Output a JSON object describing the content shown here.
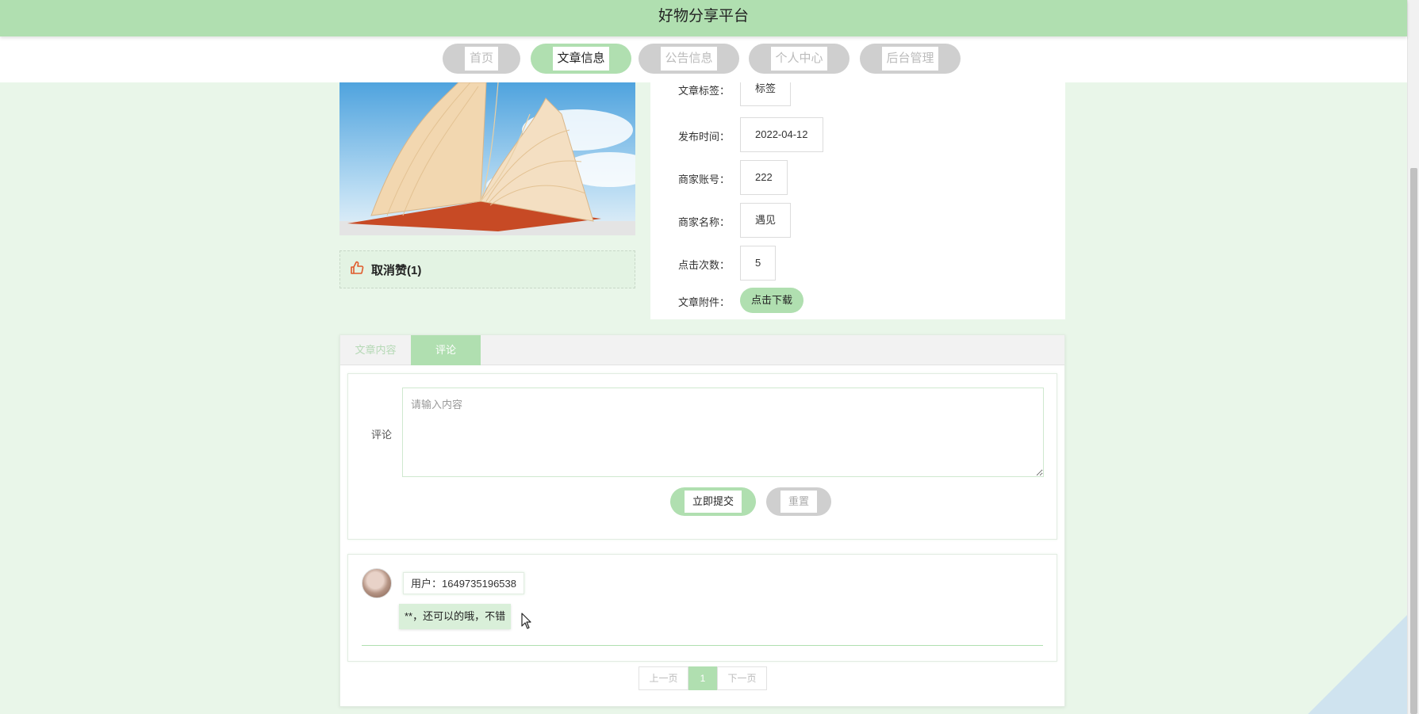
{
  "header": {
    "title": "好物分享平台"
  },
  "nav": {
    "items": [
      {
        "label": "首页"
      },
      {
        "label": "文章信息"
      },
      {
        "label": "公告信息"
      },
      {
        "label": "个人中心"
      },
      {
        "label": "后台管理"
      }
    ],
    "active_index": 1
  },
  "article": {
    "like_label": "取消赞(1)",
    "fields": [
      {
        "label": "文章标签：",
        "value": "标签"
      },
      {
        "label": "发布时间：",
        "value": "2022-04-12"
      },
      {
        "label": "商家账号：",
        "value": "222"
      },
      {
        "label": "商家名称：",
        "value": "遇见"
      },
      {
        "label": "点击次数：",
        "value": "5"
      }
    ],
    "attachment_label": "文章附件：",
    "download_label": "点击下载"
  },
  "tabs": [
    {
      "label": "文章内容"
    },
    {
      "label": "评论"
    }
  ],
  "comment_form": {
    "label": "评论",
    "placeholder": "请输入内容",
    "submit_label": "立即提交",
    "reset_label": "重置"
  },
  "comments": [
    {
      "user": "用户：1649735196538",
      "text": "**，还可以的哦，不错"
    }
  ],
  "pagination": {
    "prev": "上一页",
    "current": "1",
    "next": "下一页"
  },
  "colors": {
    "accent_green": "#b0dfb0",
    "page_bg": "#e9f6e9",
    "inactive_gray": "#cfcfcf",
    "like_icon": "#e05a2b"
  }
}
